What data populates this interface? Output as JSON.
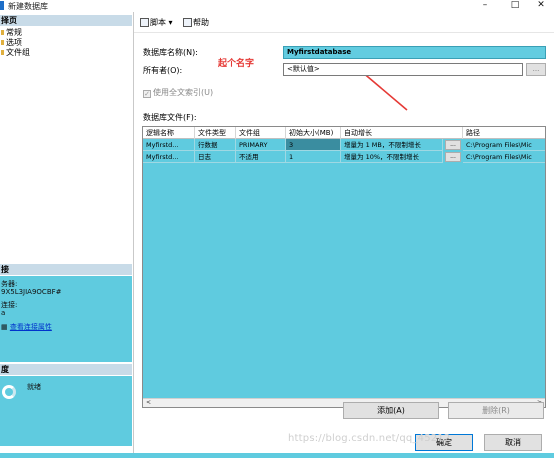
{
  "window": {
    "title": "新建数据库",
    "controls": {
      "minimize": "–",
      "maximize": "□",
      "close": "✕"
    }
  },
  "sidebar": {
    "pages_header": "择页",
    "items": [
      {
        "label": "常规"
      },
      {
        "label": "选项"
      },
      {
        "label": "文件组"
      }
    ],
    "connection_header": "接",
    "server_label": "务器:",
    "server_value": "9X5L3JIA9OCBF#",
    "connection_label": "连接:",
    "connection_value": "a",
    "view_props_link": "查看连接属性",
    "progress_header": "度",
    "progress_status": "就绪"
  },
  "toolbar": {
    "script_label": "脚本",
    "script_icon": "script-icon",
    "help_label": "帮助",
    "help_icon": "help-icon"
  },
  "form": {
    "db_name_label": "数据库名称(N):",
    "db_name_value": "Myfirstdatabase",
    "annotation": "起个名字",
    "owner_label": "所有者(O):",
    "owner_value": "<默认值>",
    "ellipsis": "...",
    "fulltext_label": "使用全文索引(U)",
    "files_label": "数据库文件(F):"
  },
  "grid": {
    "columns": [
      "逻辑名称",
      "文件类型",
      "文件组",
      "初始大小(MB)",
      "自动增长",
      "路径"
    ],
    "rows": [
      {
        "name": "Myfirstd...",
        "type": "行数据",
        "filegroup": "PRIMARY",
        "size": "3",
        "growth": "增量为 1 MB，不限制增长",
        "path": "C:\\Program Files\\Mic"
      },
      {
        "name": "Myfirstd...",
        "type": "日志",
        "filegroup": "不适用",
        "size": "1",
        "growth": "增量为 10%，不限制增长",
        "path": "C:\\Program Files\\Mic"
      }
    ],
    "cell_button": "...",
    "scroll_left": "<",
    "scroll_right": ">"
  },
  "buttons": {
    "add": "添加(A)",
    "remove": "删除(R)",
    "ok": "确定",
    "cancel": "取消"
  },
  "watermark": "https://blog.csdn.net/qq_45212"
}
